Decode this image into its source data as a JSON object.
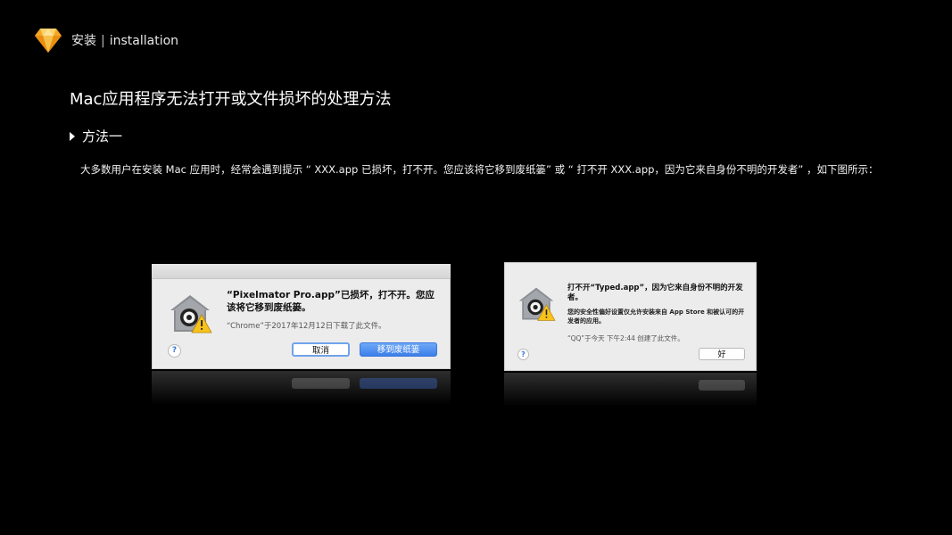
{
  "header": {
    "section": "安装",
    "separator": "|",
    "subtitle": "installation"
  },
  "title": "Mac应用程序无法打开或文件损坏的处理方法",
  "method": "方法一",
  "description": "大多数用户在安装 Mac 应用时，经常会遇到提示 “ XXX.app 已损坏，打不开。您应该将它移到废纸篓” 或 “ 打不开 XXX.app，因为它来自身份不明的开发者” ，如下图所示：",
  "dialog1": {
    "title": "“Pixelmator Pro.app”已损坏，打不开。您应该将它移到废纸篓。",
    "note": "“Chrome”于2017年12月12日下载了此文件。",
    "help": "?",
    "cancel_label": "取消",
    "trash_label": "移到废纸篓"
  },
  "dialog2": {
    "title": "打不开“Typed.app”，因为它来自身份不明的开发者。",
    "body": "您的安全性偏好设置仅允许安装来自 App Store 和被认可的开发者的应用。",
    "note": "“QQ”于今天 下午2:44 创建了此文件。",
    "help": "?",
    "ok_label": "好"
  },
  "colors": {
    "background": "#000000",
    "accent_button": "#3b7ee8",
    "logo": "#f5a623"
  },
  "icons": [
    "sketch-logo-icon",
    "caret-right-icon",
    "gatekeeper-icon",
    "help-icon"
  ]
}
